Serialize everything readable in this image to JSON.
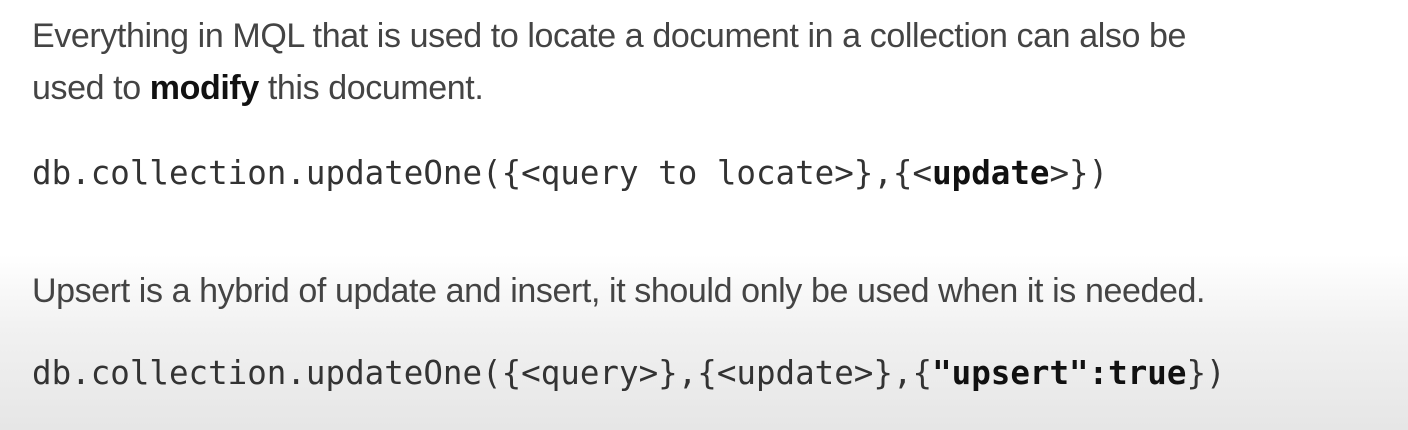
{
  "intro": {
    "line1": "Everything in MQL that is used to locate a document in a collection can also be",
    "line2_before": "used to ",
    "line2_bold": "modify",
    "line2_after": " this document."
  },
  "code_update": {
    "prefix": "db.collection.updateOne({<query to locate>},{<",
    "bold": "update",
    "suffix": ">})"
  },
  "upsert_text": "Upsert is a hybrid of update and insert, it should only be used when it is needed.",
  "code_upsert": {
    "prefix": "db.collection.updateOne({<query>},{<update>},{",
    "bold": "\"upsert\":true",
    "suffix": "})"
  }
}
